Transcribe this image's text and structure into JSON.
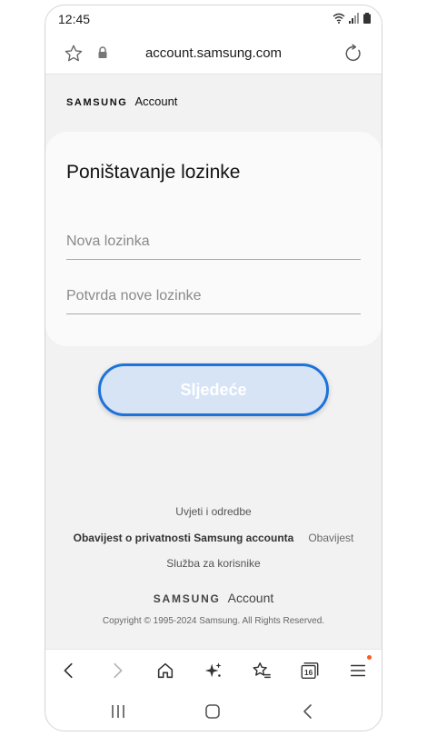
{
  "status": {
    "time": "12:45"
  },
  "browser": {
    "url": "account.samsung.com",
    "tab_count": "16"
  },
  "header": {
    "brand_samsung": "SAMSUNG",
    "brand_account": "Account"
  },
  "form": {
    "title": "Poništavanje lozinke",
    "new_password_placeholder": "Nova lozinka",
    "confirm_password_placeholder": "Potvrda nove lozinke",
    "next_label": "Sljedeće"
  },
  "footer": {
    "terms": "Uvjeti i odredbe",
    "privacy": "Obavijest o privatnosti Samsung accounta",
    "notice": "Obavijest",
    "support": "Služba za korisnike",
    "brand_samsung": "SAMSUNG",
    "brand_account": "Account",
    "copyright": "Copyright © 1995-2024 Samsung. All Rights Reserved."
  },
  "colors": {
    "accent": "#1e73d9",
    "button_fill": "#d6e4f6",
    "background": "#f2f2f2",
    "notification_dot": "#ff5a1f"
  },
  "icons": {
    "toolbar": [
      "back-icon",
      "forward-icon",
      "home-icon",
      "sparkle-icon",
      "bookmarks-icon",
      "tabs-icon",
      "menu-icon"
    ],
    "navigation": [
      "recent-apps-icon",
      "home-nav-icon",
      "back-nav-icon"
    ]
  }
}
